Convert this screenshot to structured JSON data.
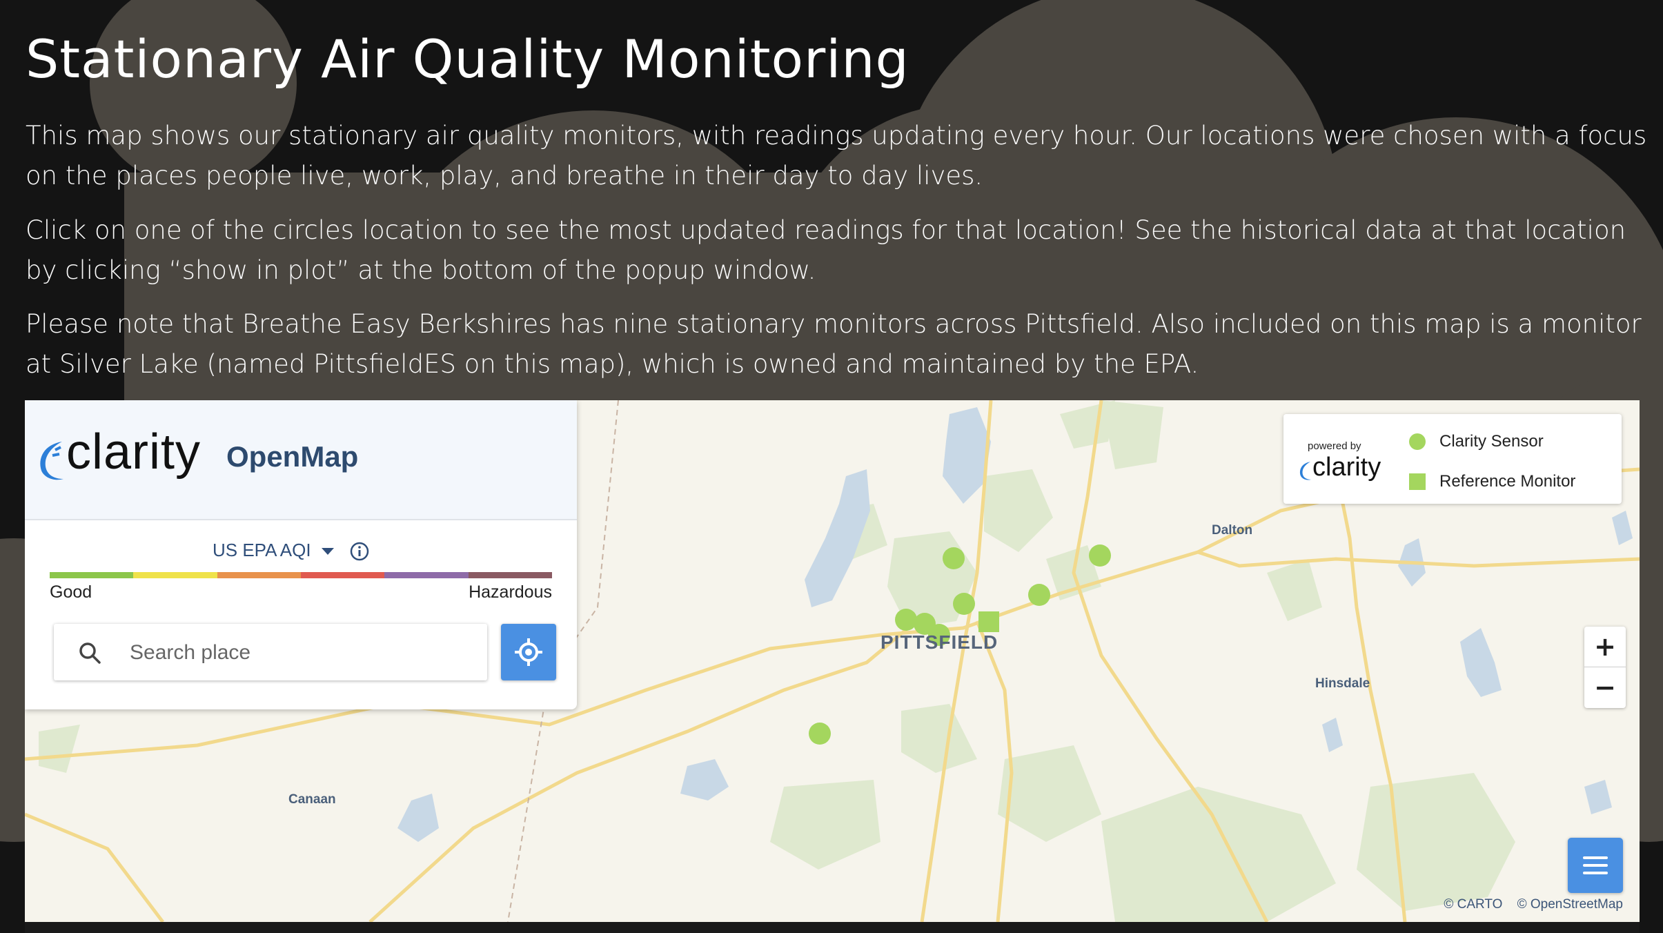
{
  "page": {
    "title": "Stationary Air Quality Monitoring",
    "paragraphs": [
      "This map shows our stationary air quality monitors, with readings updating every hour. Our locations were chosen with a focus on the places people live, work, play, and breathe in their day to day lives.",
      "Click on one of the circles location to see the most updated readings for that location! See the historical data at that location by clicking “show in plot” at the bottom of the popup window.",
      "Please note that Breathe Easy Berkshires has nine stationary monitors across Pittsfield. Also included on this map is a monitor at Silver Lake (named PittsfieldES on this map), which is owned and maintained by the EPA."
    ]
  },
  "map": {
    "brand": "clarity",
    "product": "OpenMap",
    "aqi_standard": "US EPA AQI",
    "scale_low": "Good",
    "scale_high": "Hazardous",
    "aqi_colors": [
      "#8cc64a",
      "#efe24a",
      "#e8924c",
      "#e05a50",
      "#8e6ba8",
      "#8a5a62"
    ],
    "search_placeholder": "Search place",
    "legend": {
      "powered_by": "powered by",
      "brand": "clarity",
      "items": [
        "Clarity Sensor",
        "Reference Monitor"
      ],
      "sensor_color": "#a4d65e"
    },
    "places": {
      "city": "PITTSFIELD",
      "dalton": "Dalton",
      "hinsdale": "Hinsdale",
      "canaan": "Canaan"
    },
    "zoom_in": "+",
    "zoom_out": "−",
    "attribution": [
      "© CARTO",
      "© OpenStreetMap"
    ],
    "icons": [
      "clarity-logo-icon",
      "dropdown-caret-icon",
      "info-icon",
      "search-icon",
      "locate-icon",
      "hamburger-menu-icon"
    ]
  }
}
